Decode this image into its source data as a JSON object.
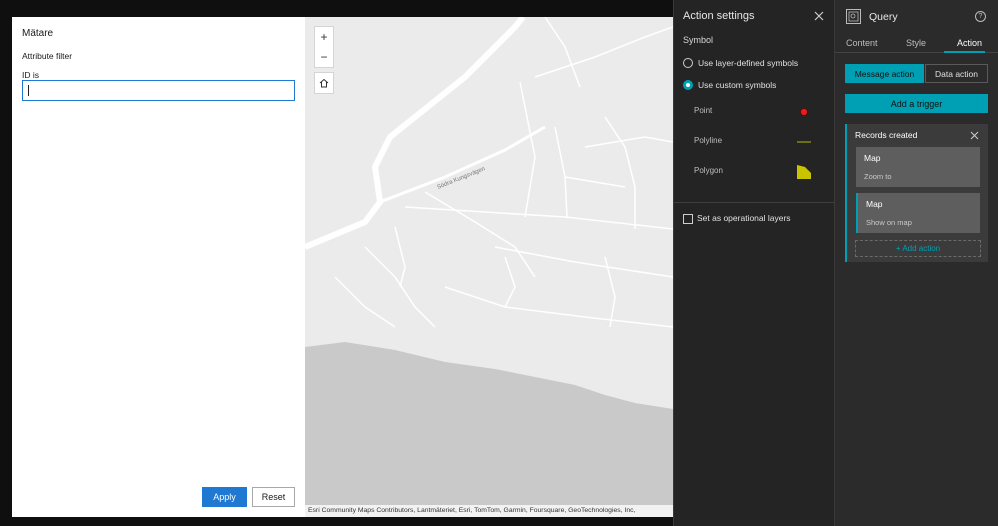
{
  "widget": {
    "title": "Mätare",
    "filter_label": "Attribute filter",
    "field_label": "ID is",
    "field_value": "",
    "apply_label": "Apply",
    "reset_label": "Reset"
  },
  "map": {
    "zoom_in": "+",
    "zoom_out": "−",
    "home_icon": "home-icon",
    "street_label": "Södra Kungsvägen",
    "attribution": "Esri Community Maps Contributors, Lantmäteriet, Esri, TomTom, Garmin, Foursquare, GeoTechnologies, Inc,"
  },
  "action_settings": {
    "title": "Action settings",
    "symbol_label": "Symbol",
    "options": [
      "Use layer-defined symbols",
      "Use custom symbols"
    ],
    "selected_option": "Use custom symbols",
    "symbols": [
      {
        "label": "Point",
        "color": "#e02020"
      },
      {
        "label": "Polyline",
        "color": "#b4b800"
      },
      {
        "label": "Polygon",
        "color": "#c8c400"
      }
    ],
    "operational_label": "Set as operational layers",
    "operational_checked": false
  },
  "query_panel": {
    "title": "Query",
    "tabs": [
      "Content",
      "Style",
      "Action"
    ],
    "active_tab": "Action",
    "message_action": "Message action",
    "data_action": "Data action",
    "add_trigger": "Add a trigger",
    "trigger": {
      "title": "Records created",
      "actions": [
        {
          "target": "Map",
          "action": "Zoom to"
        },
        {
          "target": "Map",
          "action": "Show on map"
        }
      ],
      "add_action": "+ Add action"
    },
    "accent": "#00a0b4"
  }
}
